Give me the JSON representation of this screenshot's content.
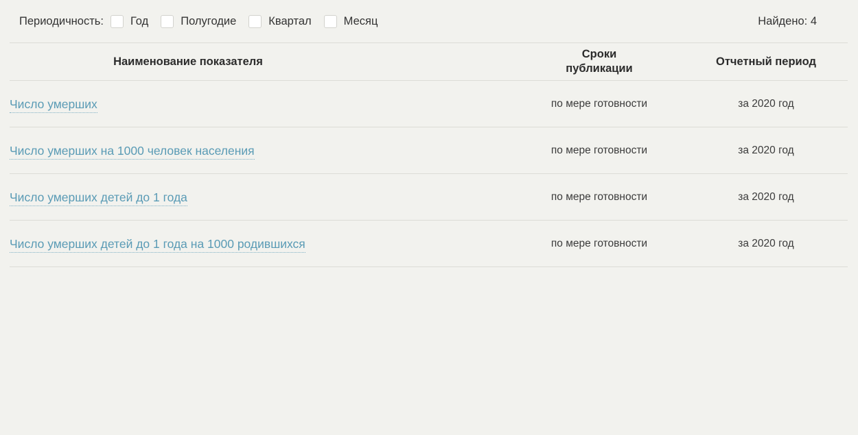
{
  "filter": {
    "label": "Периодичность:",
    "options": [
      {
        "label": "Год",
        "checked": false
      },
      {
        "label": "Полугодие",
        "checked": false
      },
      {
        "label": "Квартал",
        "checked": false
      },
      {
        "label": "Месяц",
        "checked": false
      }
    ],
    "found_text": "Найдено: 4"
  },
  "table": {
    "headers": {
      "name": "Наименование показателя",
      "terms_line1": "Сроки",
      "terms_line2": "публикации",
      "period": "Отчетный период"
    },
    "rows": [
      {
        "name": "Число умерших",
        "terms": "по мере готовности",
        "period": "за 2020 год"
      },
      {
        "name": "Число умерших на 1000 человек населения",
        "terms": "по мере готовности",
        "period": "за 2020 год"
      },
      {
        "name": "Число умерших детей до 1 года",
        "terms": "по мере готовности",
        "period": "за 2020 год"
      },
      {
        "name": "Число умерших детей до 1 года на 1000 родившихся",
        "terms": "по мере готовности",
        "period": "за 2020 год"
      }
    ]
  },
  "colors": {
    "background": "#f2f2ee",
    "link": "#5a9bb5",
    "divider": "#dcdcd6",
    "text": "#333333"
  }
}
